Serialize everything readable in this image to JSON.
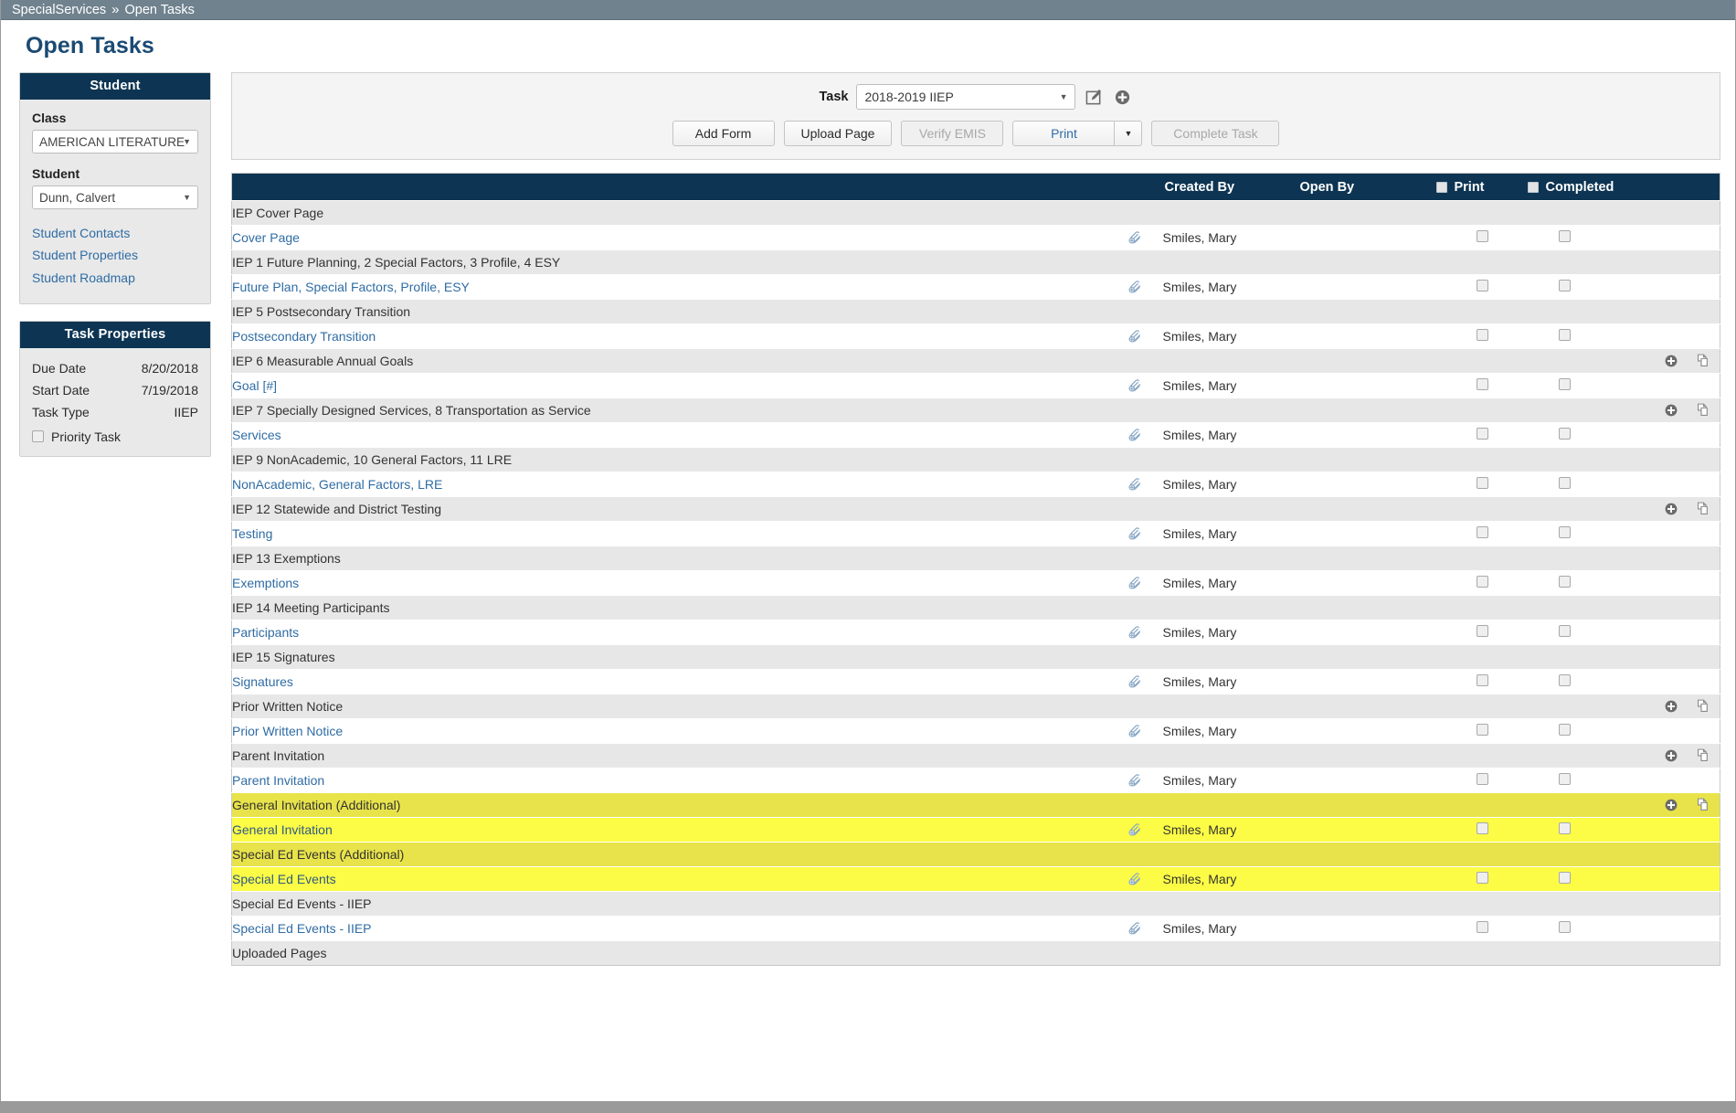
{
  "breadcrumb": {
    "root": "SpecialServices",
    "separator": "»",
    "current": "Open Tasks"
  },
  "page": {
    "title": "Open Tasks"
  },
  "sidebar": {
    "student_panel": {
      "title": "Student",
      "class_label": "Class",
      "class_value": "AMERICAN LITERATURE",
      "student_label": "Student",
      "student_value": "Dunn, Calvert",
      "links": [
        {
          "label": "Student Contacts"
        },
        {
          "label": "Student Properties"
        },
        {
          "label": "Student Roadmap"
        }
      ]
    },
    "task_properties": {
      "title": "Task Properties",
      "rows": [
        {
          "label": "Due Date",
          "value": "8/20/2018"
        },
        {
          "label": "Start Date",
          "value": "7/19/2018"
        },
        {
          "label": "Task Type",
          "value": "IIEP"
        }
      ],
      "priority_label": "Priority Task",
      "priority_checked": false
    }
  },
  "toolbar": {
    "task_label": "Task",
    "task_value": "2018-2019 IIEP",
    "edit_icon": "edit-pencil-icon",
    "add_icon": "plus-circle-icon",
    "buttons": {
      "add_form": "Add Form",
      "upload_page": "Upload Page",
      "verify_emis": "Verify EMIS",
      "print": "Print",
      "complete_task": "Complete Task"
    }
  },
  "table": {
    "headers": {
      "name": "",
      "clip": "",
      "created_by": "Created By",
      "open_by": "Open By",
      "print": "Print",
      "completed": "Completed"
    },
    "created_by_default": "Smiles, Mary",
    "row_icon": "paperclip-add-icon",
    "action_icons": {
      "add": "plus-circle-icon",
      "copy": "copy-pages-icon"
    },
    "rows": [
      {
        "type": "group",
        "label": "IEP Cover Page",
        "highlight": false,
        "actions": false
      },
      {
        "type": "item",
        "label": "Cover Page",
        "created_by": "Smiles, Mary",
        "open_by": "",
        "highlight": false
      },
      {
        "type": "group",
        "label": "IEP 1 Future Planning, 2 Special Factors, 3 Profile, 4 ESY",
        "highlight": false,
        "actions": false
      },
      {
        "type": "item",
        "label": "Future Plan, Special Factors, Profile, ESY",
        "created_by": "Smiles, Mary",
        "open_by": "",
        "highlight": false
      },
      {
        "type": "group",
        "label": "IEP 5 Postsecondary Transition",
        "highlight": false,
        "actions": false
      },
      {
        "type": "item",
        "label": "Postsecondary Transition",
        "created_by": "Smiles, Mary",
        "open_by": "",
        "highlight": false
      },
      {
        "type": "group",
        "label": "IEP 6 Measurable Annual Goals",
        "highlight": false,
        "actions": true
      },
      {
        "type": "item",
        "label": "Goal [#]",
        "created_by": "Smiles, Mary",
        "open_by": "",
        "highlight": false
      },
      {
        "type": "group",
        "label": "IEP 7 Specially Designed Services, 8 Transportation as Service",
        "highlight": false,
        "actions": true
      },
      {
        "type": "item",
        "label": "Services",
        "created_by": "Smiles, Mary",
        "open_by": "",
        "highlight": false
      },
      {
        "type": "group",
        "label": "IEP 9 NonAcademic, 10 General Factors, 11 LRE",
        "highlight": false,
        "actions": false
      },
      {
        "type": "item",
        "label": "NonAcademic, General Factors, LRE",
        "created_by": "Smiles, Mary",
        "open_by": "",
        "highlight": false
      },
      {
        "type": "group",
        "label": "IEP 12 Statewide and District Testing",
        "highlight": false,
        "actions": true
      },
      {
        "type": "item",
        "label": "Testing",
        "created_by": "Smiles, Mary",
        "open_by": "",
        "highlight": false
      },
      {
        "type": "group",
        "label": "IEP 13 Exemptions",
        "highlight": false,
        "actions": false
      },
      {
        "type": "item",
        "label": "Exemptions",
        "created_by": "Smiles, Mary",
        "open_by": "",
        "highlight": false
      },
      {
        "type": "group",
        "label": "IEP 14 Meeting Participants",
        "highlight": false,
        "actions": false
      },
      {
        "type": "item",
        "label": "Participants",
        "created_by": "Smiles, Mary",
        "open_by": "",
        "highlight": false
      },
      {
        "type": "group",
        "label": "IEP 15 Signatures",
        "highlight": false,
        "actions": false
      },
      {
        "type": "item",
        "label": "Signatures",
        "created_by": "Smiles, Mary",
        "open_by": "",
        "highlight": false
      },
      {
        "type": "group",
        "label": "Prior Written Notice",
        "highlight": false,
        "actions": true
      },
      {
        "type": "item",
        "label": "Prior Written Notice",
        "created_by": "Smiles, Mary",
        "open_by": "",
        "highlight": false
      },
      {
        "type": "group",
        "label": "Parent Invitation",
        "highlight": false,
        "actions": true
      },
      {
        "type": "item",
        "label": "Parent Invitation",
        "created_by": "Smiles, Mary",
        "open_by": "",
        "highlight": false
      },
      {
        "type": "group",
        "label": "General Invitation (Additional)",
        "highlight": true,
        "actions": true
      },
      {
        "type": "item",
        "label": "General Invitation",
        "created_by": "Smiles, Mary",
        "open_by": "",
        "highlight": true
      },
      {
        "type": "group",
        "label": "Special Ed Events (Additional)",
        "highlight": true,
        "actions": false
      },
      {
        "type": "item",
        "label": "Special Ed Events",
        "created_by": "Smiles, Mary",
        "open_by": "",
        "highlight": true
      },
      {
        "type": "group",
        "label": "Special Ed Events - IIEP",
        "highlight": false,
        "actions": false
      },
      {
        "type": "item",
        "label": "Special Ed Events - IIEP",
        "created_by": "Smiles, Mary",
        "open_by": "",
        "highlight": false
      },
      {
        "type": "group",
        "label": "Uploaded Pages",
        "highlight": false,
        "actions": false
      }
    ]
  }
}
